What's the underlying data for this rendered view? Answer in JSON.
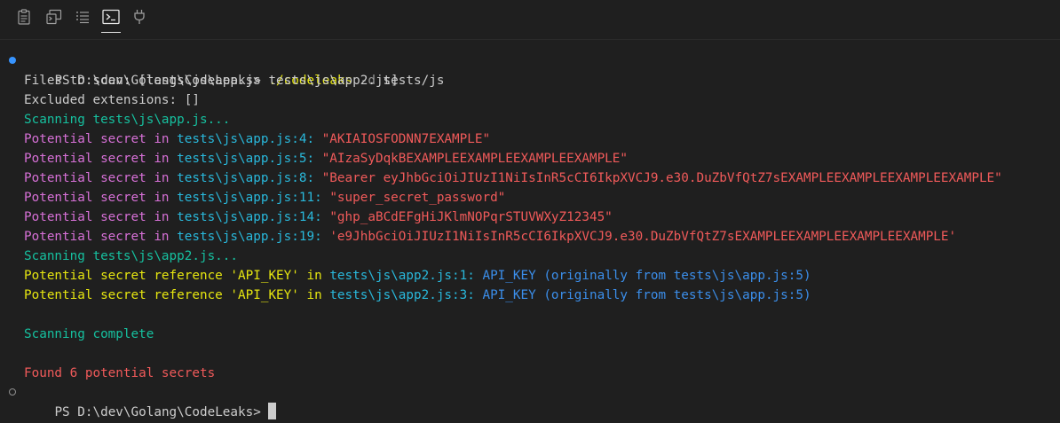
{
  "colors": {
    "background": "#1f1f1f",
    "default_text": "#cccccc",
    "yellow": "#e5e510",
    "green": "#16c09f",
    "purple": "#d670d6",
    "cyan": "#29b8db",
    "red": "#f05a5a",
    "blue": "#3b8eea",
    "active_marker": "#3794ff"
  },
  "panel": {
    "tabs": [
      {
        "icon": "clipboard-icon",
        "active": false
      },
      {
        "icon": "debug-console-icon",
        "active": false
      },
      {
        "icon": "list-icon",
        "active": false
      },
      {
        "icon": "terminal-icon",
        "active": true
      },
      {
        "icon": "plug-icon",
        "active": false
      }
    ]
  },
  "terminal": {
    "prompt": "PS D:\\dev\\Golang\\CodeLeaks> ",
    "command": {
      "program": "./codeleaks",
      "flag": "-d",
      "arg": "tests/js"
    },
    "files_to_scan": "Files to scan: [tests\\js\\app.js tests\\js\\app2.js]",
    "excluded": "Excluded extensions: []",
    "scanning_1": "Scanning tests\\js\\app.js...",
    "secrets_label": "Potential secret in",
    "secrets": [
      {
        "location": "tests\\js\\app.js:4:",
        "value": "\"AKIAIOSFODNN7EXAMPLE\""
      },
      {
        "location": "tests\\js\\app.js:5:",
        "value": "\"AIzaSyDqkBEXAMPLEEXAMPLEEXAMPLEEXAMPLE\""
      },
      {
        "location": "tests\\js\\app.js:8:",
        "value": "\"Bearer eyJhbGciOiJIUzI1NiIsInR5cCI6IkpXVCJ9.e30.DuZbVfQtZ7sEXAMPLEEXAMPLEEXAMPLEEXAMPLE\""
      },
      {
        "location": "tests\\js\\app.js:11:",
        "value": "\"super_secret_password\""
      },
      {
        "location": "tests\\js\\app.js:14:",
        "value": "\"ghp_aBCdEFgHiJKlmNOPqrSTUVWXyZ12345\""
      },
      {
        "location": "tests\\js\\app.js:19:",
        "value": "'e9JhbGciOiJIUzI1NiIsInR5cCI6IkpXVCJ9.e30.DuZbVfQtZ7sEXAMPLEEXAMPLEEXAMPLEEXAMPLE'"
      }
    ],
    "scanning_2": "Scanning tests\\js\\app2.js...",
    "references": [
      {
        "label": "Potential secret reference 'API_KEY' in",
        "location": "tests\\js\\app2.js:1:",
        "origin": "API_KEY (originally from tests\\js\\app.js:5)"
      },
      {
        "label": "Potential secret reference 'API_KEY' in",
        "location": "tests\\js\\app2.js:3:",
        "origin": "API_KEY (originally from tests\\js\\app.js:5)"
      }
    ],
    "complete": "Scanning complete",
    "found": "Found 6 potential secrets",
    "final_prompt": "PS D:\\dev\\Golang\\CodeLeaks> "
  }
}
